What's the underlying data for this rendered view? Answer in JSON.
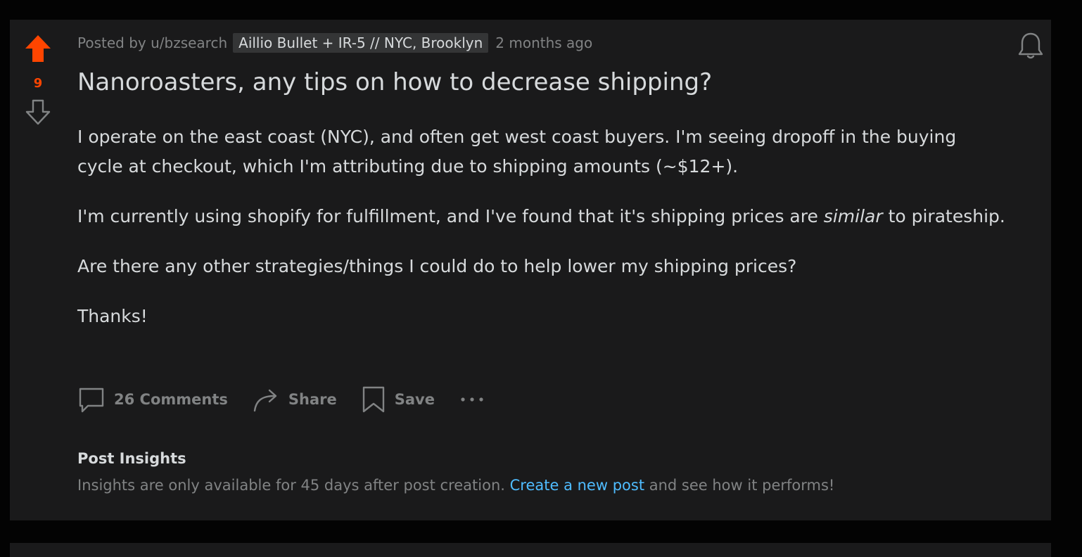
{
  "post": {
    "score": "9",
    "meta": {
      "posted_by": "Posted by u/bzsearch",
      "flair": "Aillio Bullet + IR-5 // NYC, Brooklyn",
      "time": "2 months ago"
    },
    "title": "Nanoroasters, any tips on how to decrease shipping?",
    "body": {
      "p1": "I operate on the east coast (NYC), and often get west coast buyers. I'm seeing dropoff in the buying cycle at checkout, which I'm attributing due to shipping amounts (~$12+).",
      "p2_before": "I'm currently using shopify for fulfillment, and I've found that it's shipping prices are ",
      "p2_em": "similar",
      "p2_after": " to pirateship.",
      "p3": "Are there any other strategies/things I could do to help lower my shipping prices?",
      "p4": "Thanks!"
    },
    "actions": {
      "comments_label": "26 Comments",
      "share_label": "Share",
      "save_label": "Save"
    },
    "insights": {
      "title": "Post Insights",
      "text_before": "Insights are only available for 45 days after post creation. ",
      "link": "Create a new post",
      "text_after": " and see how it performs!"
    }
  },
  "icons": [
    "upvote-arrow-icon",
    "downvote-arrow-icon",
    "bell-icon",
    "comment-icon",
    "share-icon",
    "bookmark-icon",
    "more-icon"
  ],
  "colors": {
    "background": "#030303",
    "card": "#1a1a1b",
    "upvote": "#ff4500",
    "text": "#d7dadc",
    "muted": "#818384",
    "link": "#4fbcff",
    "flair_bg": "#343536"
  }
}
